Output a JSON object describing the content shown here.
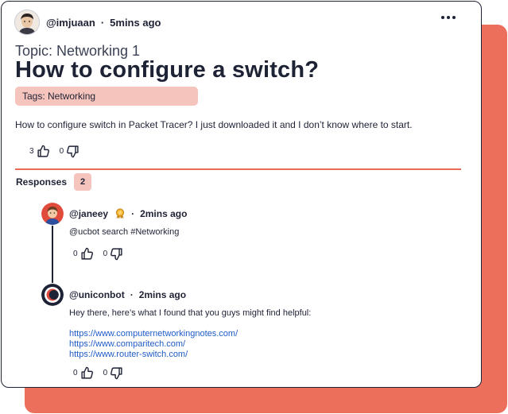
{
  "post": {
    "username": "@imjuaan",
    "time": "5mins ago",
    "topic": "Topic: Networking 1",
    "title": "How to configure a switch?",
    "tags": "Tags: Networking",
    "body": "How to configure switch in Packet Tracer? I just downloaded it and I don’t know where to start.",
    "upvotes": "3",
    "downvotes": "0"
  },
  "responses": {
    "label": "Responses",
    "count": "2",
    "items": [
      {
        "username": "@janeey",
        "time": "2mins ago",
        "text": "@ucbot search #Networking",
        "upvotes": "0",
        "downvotes": "0"
      },
      {
        "username": "@uniconbot",
        "time": "2mins ago",
        "text": "Hey there, here’s what I found that you guys might find helpful:",
        "links": [
          "https://www.computernetworkingnotes.com/",
          "https://www.comparitech.com/",
          "https://www.router-switch.com/"
        ],
        "upvotes": "0",
        "downvotes": "0"
      }
    ]
  },
  "colors": {
    "accent": "#ec6f5c",
    "tag_bg": "#f5c4bc",
    "text": "#1e2235",
    "link": "#1f5bc6"
  },
  "icons": [
    "more-dots-icon",
    "thumbs-up-icon",
    "thumbs-down-icon",
    "badge-icon"
  ]
}
